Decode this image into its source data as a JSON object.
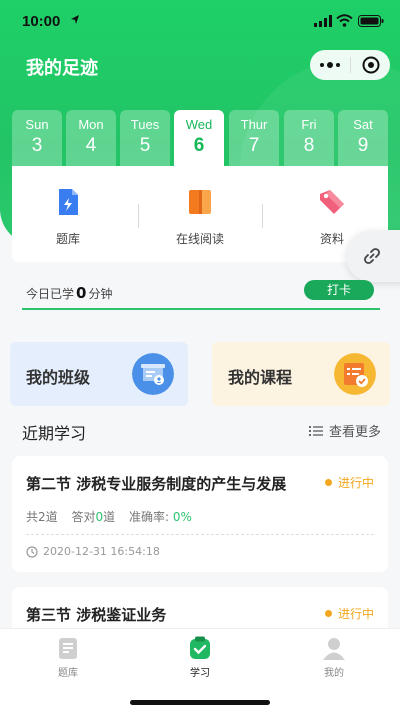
{
  "statusbar": {
    "time": "10:00"
  },
  "header": {
    "title": "我的足迹"
  },
  "days": [
    {
      "name": "Sun",
      "num": "3"
    },
    {
      "name": "Mon",
      "num": "4"
    },
    {
      "name": "Tues",
      "num": "5"
    },
    {
      "name": "Wed",
      "num": "6",
      "active": true
    },
    {
      "name": "Thur",
      "num": "7"
    },
    {
      "name": "Fri",
      "num": "8"
    },
    {
      "name": "Sat",
      "num": "9"
    }
  ],
  "entries": [
    {
      "label": "题库",
      "icon": "document-icon"
    },
    {
      "label": "在线阅读",
      "icon": "book-icon"
    },
    {
      "label": "资料",
      "icon": "tag-icon"
    }
  ],
  "today": {
    "prefix": "今日已学",
    "minutes": "0",
    "suffix": "分钟",
    "checkin_label": "打卡"
  },
  "cards": {
    "class_label": "我的班级",
    "course_label": "我的课程"
  },
  "recent": {
    "title": "近期学习",
    "more_label": "查看更多",
    "items": [
      {
        "title": "第二节 涉税专业服务制度的产生与发展",
        "status": "进行中",
        "total_prefix": "共",
        "total": "2",
        "total_suffix": "道",
        "correct_prefix": "答对",
        "correct": "0",
        "correct_suffix": "道",
        "accuracy_label": "准确率:",
        "accuracy": "0%",
        "time": "2020-12-31 16:54:18"
      },
      {
        "title": "第三节 涉税鉴证业务",
        "status": "进行中"
      }
    ]
  },
  "tabbar": [
    {
      "label": "题库"
    },
    {
      "label": "学习",
      "active": true
    },
    {
      "label": "我的"
    }
  ],
  "colors": {
    "brand_green": "#1ed067",
    "status_orange": "#f4a61d",
    "class_card": "#e4eefc",
    "course_card": "#fdf3e1"
  }
}
